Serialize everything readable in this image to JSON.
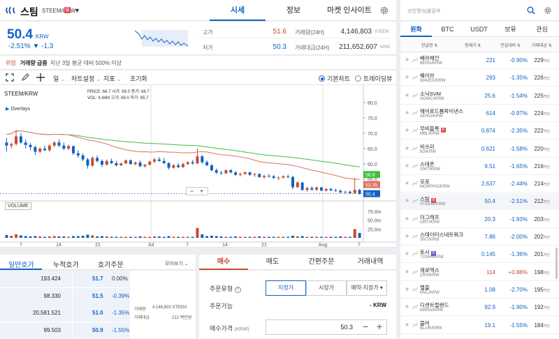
{
  "header": {
    "coin_name": "스팀",
    "pair": "STEEM/KRW",
    "warning_badge": "유",
    "tabs": [
      "시세",
      "정보",
      "마켓 인사이트"
    ]
  },
  "price": {
    "current": "50.4",
    "unit": "KRW",
    "change": "-2.51% ▼ -1.3",
    "high_label": "고가",
    "high": "51.6",
    "low_label": "저가",
    "low": "50.3",
    "vol_label": "거래량(24H)",
    "vol": "4,146,803",
    "vol_unit": "STEEM",
    "amt_label": "거래대금(24H)",
    "amt": "211,652,607",
    "amt_unit": "KRW"
  },
  "alert": {
    "tag": "위험",
    "title": "거래량 급증",
    "text": "지난 3일 평균 대비 500% 이상"
  },
  "toolbar": {
    "interval": "일",
    "chart_settings": "차트설정",
    "indicators": "지표",
    "reset": "초기화",
    "basic_chart": "기본차트",
    "trading_view": "트레이딩뷰"
  },
  "chart_header": {
    "pair": "STEEM/KRW",
    "overlays": "Overlays",
    "volume_label": "VOLUME",
    "info_line1": "PRICE: 66.7    시가: 69.0    종가: 66.7",
    "info_line2": "VOL:    4.84M   고가: 69.0    저가: 65.7"
  },
  "chart_data": {
    "type": "candlestick",
    "price_ticks": [
      80.0,
      75.0,
      70.0,
      65.0,
      60.0,
      55.0,
      50.0
    ],
    "price_range": [
      48.5,
      82
    ],
    "volume_ticks": [
      "75.0m",
      "50.0m",
      "25.0m"
    ],
    "volume_range": [
      0,
      85
    ],
    "x_labels": [
      "7",
      "14",
      "21",
      "Jul",
      "7",
      "14",
      "21",
      "Aug",
      "7"
    ],
    "ma_long_label": "56.6",
    "ma_short_label": "53.35",
    "last_price_label": "50.4",
    "candles": [
      [
        67,
        68.5,
        64,
        66,
        8
      ],
      [
        66,
        67,
        65,
        66.5,
        6
      ],
      [
        66.5,
        71,
        66,
        69,
        10
      ],
      [
        69,
        70,
        66.5,
        67,
        7
      ],
      [
        67,
        68,
        65,
        66.2,
        5
      ],
      [
        66.2,
        66.8,
        64.5,
        65.5,
        4
      ],
      [
        65.5,
        66,
        63,
        64,
        5
      ],
      [
        64,
        65.5,
        63.5,
        65,
        4
      ],
      [
        65,
        66,
        64.2,
        64.5,
        3
      ],
      [
        64.5,
        66.5,
        64,
        66,
        4
      ],
      [
        66,
        67.5,
        65.5,
        67,
        5
      ],
      [
        67,
        68,
        65.5,
        66,
        4
      ],
      [
        66,
        67,
        64.5,
        65,
        4
      ],
      [
        65,
        66.3,
        64.5,
        65.8,
        3
      ],
      [
        65.8,
        66,
        63,
        63.5,
        5
      ],
      [
        63.5,
        64.5,
        62,
        62.8,
        5
      ],
      [
        62.8,
        63.5,
        61,
        61.5,
        6
      ],
      [
        61.5,
        62,
        58.5,
        59.5,
        9
      ],
      [
        59.5,
        62.5,
        59,
        62,
        7
      ],
      [
        62,
        62.8,
        60.5,
        61,
        4
      ],
      [
        61,
        61.5,
        59,
        59.8,
        5
      ],
      [
        59.8,
        61.5,
        59.5,
        61,
        4
      ],
      [
        61,
        61.8,
        60,
        60.3,
        3
      ],
      [
        60.3,
        61,
        59.2,
        59.6,
        3
      ],
      [
        59.6,
        60.5,
        59.3,
        60.2,
        3
      ],
      [
        60.2,
        61.5,
        60,
        61.2,
        3
      ],
      [
        61.2,
        61.5,
        59.8,
        60,
        3
      ],
      [
        60,
        60.8,
        59.5,
        60.5,
        3
      ],
      [
        60.5,
        61.2,
        59,
        59.3,
        4
      ],
      [
        59.3,
        60,
        58.8,
        59.8,
        3
      ],
      [
        59.8,
        61,
        59.5,
        60.8,
        3
      ],
      [
        60.8,
        62,
        60.2,
        61.5,
        4
      ],
      [
        61.5,
        62.3,
        60.8,
        61,
        4
      ],
      [
        61,
        62,
        60,
        60.3,
        3
      ],
      [
        60.3,
        60.6,
        58.2,
        58.8,
        5
      ],
      [
        58.8,
        60,
        58.5,
        59.6,
        3
      ],
      [
        59.6,
        60.3,
        58.6,
        59,
        3
      ],
      [
        59,
        60.4,
        58.8,
        60,
        3
      ],
      [
        60,
        61,
        59.6,
        60.6,
        3
      ],
      [
        60.6,
        61.3,
        59.8,
        60.2,
        3
      ],
      [
        60.2,
        65,
        60,
        62.5,
        28
      ],
      [
        62.5,
        63,
        60,
        60.6,
        10
      ],
      [
        60.6,
        61.2,
        59.4,
        59.6,
        5
      ],
      [
        59.6,
        60,
        57.6,
        58,
        6
      ],
      [
        58,
        58.6,
        56.8,
        57.2,
        5
      ],
      [
        57.2,
        57.8,
        56.5,
        57,
        4
      ],
      [
        57,
        58.2,
        56.8,
        58,
        3
      ],
      [
        58,
        58.4,
        57,
        57.3,
        3
      ],
      [
        57.3,
        57.6,
        56.2,
        56.5,
        4
      ],
      [
        56.5,
        57.2,
        56,
        56.8,
        3
      ],
      [
        56.8,
        57.6,
        56.5,
        57.3,
        3
      ],
      [
        57.3,
        57.5,
        56.2,
        56.5,
        3
      ],
      [
        56.5,
        57,
        55.8,
        56.8,
        3
      ],
      [
        56.8,
        57,
        55.5,
        55.8,
        4
      ],
      [
        55.8,
        56.5,
        55.2,
        56.2,
        3
      ],
      [
        56.2,
        56.8,
        55.6,
        56,
        3
      ],
      [
        56,
        56.5,
        55.2,
        55.5,
        3
      ],
      [
        55.5,
        56,
        54.8,
        55.6,
        3
      ],
      [
        55.6,
        56.4,
        55.3,
        56,
        3
      ],
      [
        56,
        56.6,
        55.4,
        55.8,
        3
      ],
      [
        55.8,
        56.2,
        51.8,
        52.5,
        6
      ],
      [
        52.5,
        54.5,
        52.2,
        54,
        4
      ],
      [
        54,
        54.2,
        51.3,
        51.6,
        5
      ],
      [
        51.6,
        52.6,
        51,
        52.2,
        3
      ],
      [
        52.2,
        52.8,
        51.4,
        51.7,
        3
      ],
      [
        51.7,
        52.8,
        51.2,
        52.4,
        3
      ],
      [
        52.4,
        52.6,
        51.2,
        51.4,
        3
      ],
      [
        51.4,
        52.2,
        51,
        51.9,
        3
      ],
      [
        51.9,
        52.3,
        51.2,
        51.5,
        3
      ],
      [
        51.5,
        52,
        51,
        51.3,
        3
      ],
      [
        51.3,
        51.8,
        50.6,
        50.8,
        4
      ],
      [
        50.8,
        51.4,
        50.4,
        51,
        3
      ],
      [
        51,
        51.4,
        50.2,
        50.6,
        3
      ],
      [
        50.6,
        55.5,
        50.3,
        51.6,
        25
      ],
      [
        51.6,
        52,
        50.1,
        50.4,
        14
      ]
    ]
  },
  "orderbook": {
    "tabs": [
      "일반호가",
      "누적호가",
      "호가주문"
    ],
    "view_label": "모아보기",
    "rows": [
      {
        "qty": "193.424",
        "price": "51.7",
        "rate": "0.00%"
      },
      {
        "qty": "98.330",
        "price": "51.5",
        "rate": "-0.39%"
      },
      {
        "qty": "20,581.521",
        "price": "51.0",
        "rate": "-1.35%"
      },
      {
        "qty": "99.503",
        "price": "50.9",
        "rate": "-1.55%"
      }
    ],
    "info_label1": "거래량",
    "info_val1": "4,146,803 STEEM",
    "info_label2": "거래대금",
    "info_val2": "212 백만원"
  },
  "order_form": {
    "tabs": [
      "매수",
      "매도",
      "간편주문",
      "거래내역"
    ],
    "type_label": "주문유형",
    "limit": "지정가",
    "market": "시장가",
    "reserve": "예약-지정가",
    "available_label": "주문가능",
    "available_value": "- KRW",
    "price_label": "매수가격",
    "price_unit": "(KRW)",
    "price_value": "50.3"
  },
  "right_panel": {
    "search_placeholder": "코인명/심볼검색",
    "tabs": [
      "원화",
      "BTC",
      "USDT",
      "보유",
      "관심"
    ],
    "headers": [
      "한글명",
      "현재가",
      "전일대비",
      "거래대금"
    ],
    "coins": [
      {
        "name": "베라체인",
        "pair": "BERA/KRW",
        "price": "221",
        "rate": "-0.90%",
        "vol": "229",
        "badge": ""
      },
      {
        "name": "웨이브",
        "pair": "WAVES/KRW",
        "price": "293",
        "rate": "-1.35%",
        "vol": "226",
        "badge": ""
      },
      {
        "name": "소닉SVM",
        "pair": "SONIC/KRW",
        "price": "25.6",
        "rate": "-1.54%",
        "vol": "225",
        "badge": ""
      },
      {
        "name": "에어로드롬파이낸스",
        "pair": "AERO/KRW",
        "price": "614",
        "rate": "-0.97%",
        "vol": "224",
        "badge": ""
      },
      {
        "name": "무비블록",
        "pair": "MBL/KRW",
        "price": "0.874",
        "rate": "-2.35%",
        "vol": "222",
        "badge": "유"
      },
      {
        "name": "비쓰리",
        "pair": "B3/KRW",
        "price": "0.621",
        "rate": "-1.58%",
        "vol": "220",
        "badge": ""
      },
      {
        "name": "스테픈",
        "pair": "GMT/KRW",
        "price": "9.51",
        "rate": "-1.65%",
        "vol": "216",
        "badge": ""
      },
      {
        "name": "모포",
        "pair": "MORPHO/KRW",
        "price": "2,637",
        "rate": "-2.44%",
        "vol": "214",
        "badge": ""
      },
      {
        "name": "스팀",
        "pair": "STEEM/KRW",
        "price": "50.4",
        "rate": "-2.51%",
        "vol": "212",
        "badge": "유",
        "sel": true
      },
      {
        "name": "더그래프",
        "pair": "GRT/KRW",
        "price": "20.3",
        "rate": "-1.93%",
        "vol": "203",
        "badge": ""
      },
      {
        "name": "스테이터스네트워크토큰",
        "pair": "SNT/KRW",
        "price": "7.86",
        "rate": "-2.00%",
        "vol": "202",
        "badge": ""
      },
      {
        "name": "토시",
        "pair": "TOSHI/KRW",
        "price": "0.145",
        "rate": "-1.36%",
        "vol": "201",
        "badge": "유p"
      },
      {
        "name": "제로엑스",
        "pair": "ZRX/KRW",
        "price": "114",
        "rate": "+0.88%",
        "vol": "198",
        "badge": ""
      },
      {
        "name": "멜블",
        "pair": "MVL/KRW",
        "price": "1.08",
        "rate": "-2.70%",
        "vol": "195",
        "badge": ""
      },
      {
        "name": "디센트럴랜드",
        "pair": "MANA/KRW",
        "price": "92.9",
        "rate": "-1.90%",
        "vol": "192",
        "badge": ""
      },
      {
        "name": "블러",
        "pair": "BLUR/KRW",
        "price": "19.1",
        "rate": "-1.55%",
        "vol": "184",
        "badge": ""
      }
    ],
    "vol_unit": "백만"
  },
  "colors": {
    "up": "#c84a31",
    "down": "#1261c4",
    "ma_long": "#3fbf3f",
    "ma_short": "#e07060"
  }
}
